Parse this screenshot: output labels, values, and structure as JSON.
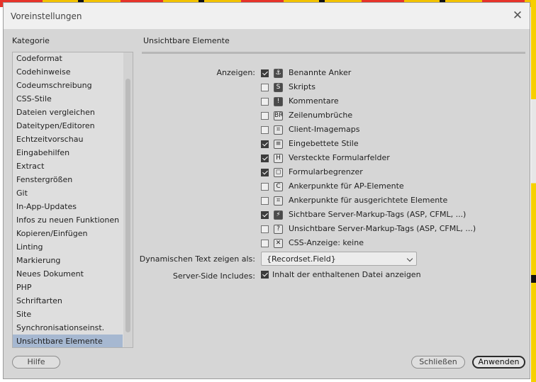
{
  "window": {
    "title": "Voreinstellungen"
  },
  "sidebar": {
    "heading": "Kategorie",
    "items": [
      "Codeformat",
      "Codehinweise",
      "Codeumschreibung",
      "CSS-Stile",
      "Dateien vergleichen",
      "Dateitypen/Editoren",
      "Echtzeitvorschau",
      "Eingabehilfen",
      "Extract",
      "Fenstergrößen",
      "Git",
      "In-App-Updates",
      "Infos zu neuen Funktionen",
      "Kopieren/Einfügen",
      "Linting",
      "Markierung",
      "Neues Dokument",
      "PHP",
      "Schriftarten",
      "Site",
      "Synchronisationseinst.",
      "Unsichtbare Elemente"
    ],
    "selected": "Unsichtbare Elemente"
  },
  "pane": {
    "title": "Unsichtbare Elemente",
    "show_label": "Anzeigen:",
    "options": [
      {
        "label": "Benannte Anker",
        "checked": true,
        "icon": "anchor-icon"
      },
      {
        "label": "Skripts",
        "checked": false,
        "icon": "script-icon"
      },
      {
        "label": "Kommentare",
        "checked": false,
        "icon": "comment-icon"
      },
      {
        "label": "Zeilenumbrüche",
        "checked": false,
        "icon": "line-break-icon"
      },
      {
        "label": "Client-Imagemaps",
        "checked": false,
        "icon": "imagemap-icon"
      },
      {
        "label": "Eingebettete Stile",
        "checked": true,
        "icon": "embedded-style-icon"
      },
      {
        "label": "Versteckte Formularfelder",
        "checked": true,
        "icon": "hidden-field-icon"
      },
      {
        "label": "Formularbegrenzer",
        "checked": true,
        "icon": "form-delimiter-icon"
      },
      {
        "label": "Ankerpunkte für AP-Elemente",
        "checked": false,
        "icon": "ap-anchor-icon"
      },
      {
        "label": "Ankerpunkte für ausgerichtete Elemente",
        "checked": false,
        "icon": "aligned-anchor-icon"
      },
      {
        "label": "Sichtbare Server-Markup-Tags (ASP, CFML, ...)",
        "checked": true,
        "icon": "visible-server-tag-icon"
      },
      {
        "label": "Unsichtbare Server-Markup-Tags (ASP, CFML, ...)",
        "checked": false,
        "icon": "invisible-server-tag-icon"
      },
      {
        "label": "CSS-Anzeige: keine",
        "checked": false,
        "icon": "css-display-none-icon"
      }
    ],
    "dynamic_text_label": "Dynamischen Text zeigen als:",
    "dynamic_text_value": "{Recordset.Field}",
    "ssi_label": "Server-Side Includes:",
    "ssi_option": {
      "label": "Inhalt der enthaltenen Datei anzeigen",
      "checked": true
    }
  },
  "buttons": {
    "help": "Hilfe",
    "close": "Schließen",
    "apply": "Anwenden"
  },
  "colors": {
    "selection": "#a6b8d1",
    "dialog_bg": "#d6d6d6"
  }
}
